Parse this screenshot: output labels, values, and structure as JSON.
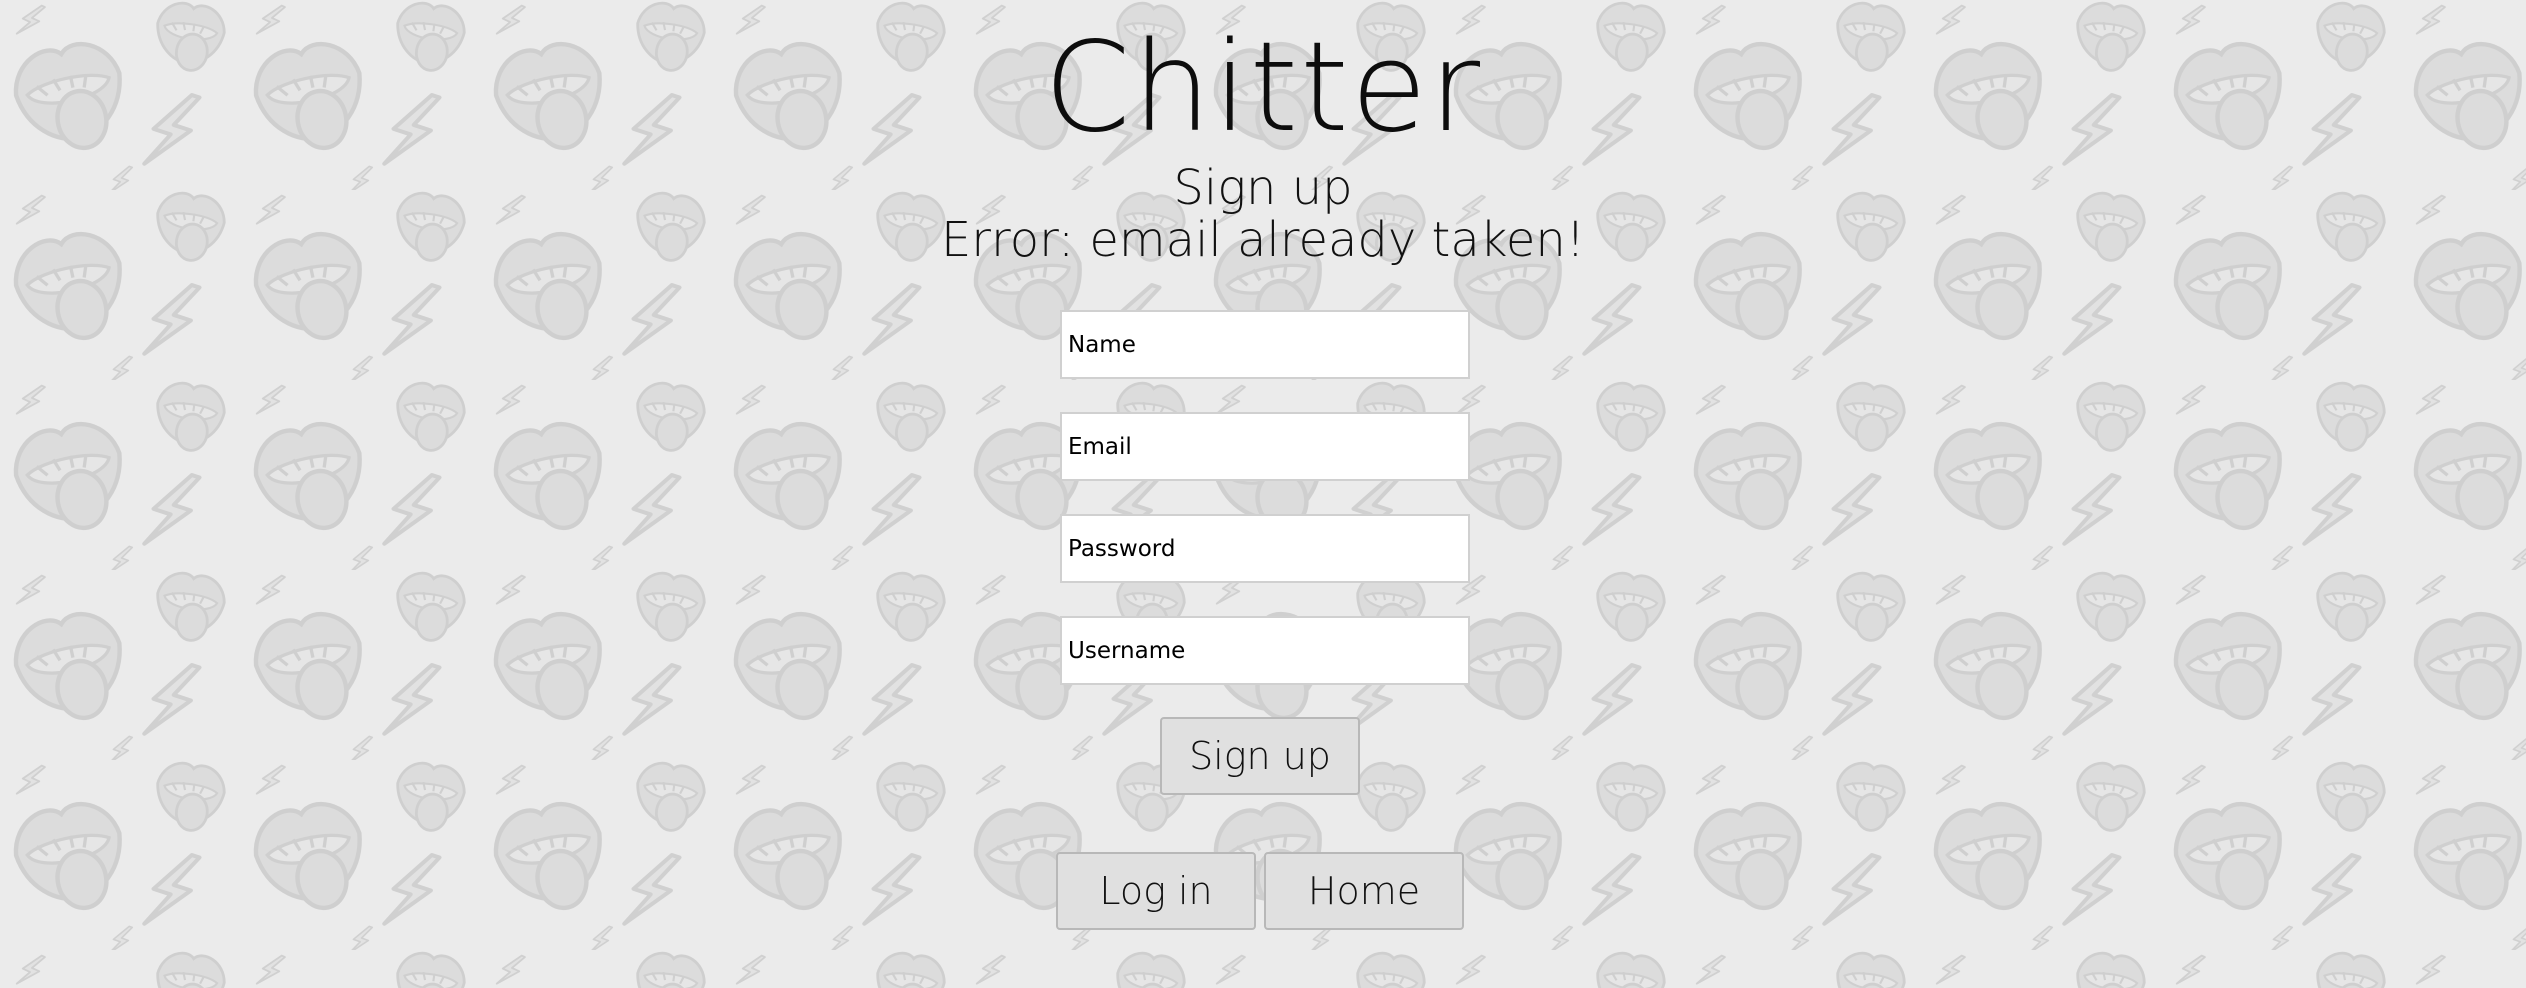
{
  "app": {
    "title": "Chitter"
  },
  "form": {
    "heading": "Sign up",
    "error": "Error: email already taken!",
    "fields": {
      "name_placeholder": "Name",
      "email_placeholder": "Email",
      "password_placeholder": "Password",
      "username_placeholder": "Username"
    },
    "submit_label": "Sign up"
  },
  "nav": {
    "login_label": "Log in",
    "home_label": "Home"
  },
  "background": {
    "color": "#ebebeb",
    "pattern_color": "#d6d6d6",
    "pattern_icons": [
      "lips-tongue-icon",
      "lightning-bolt-icon"
    ]
  }
}
